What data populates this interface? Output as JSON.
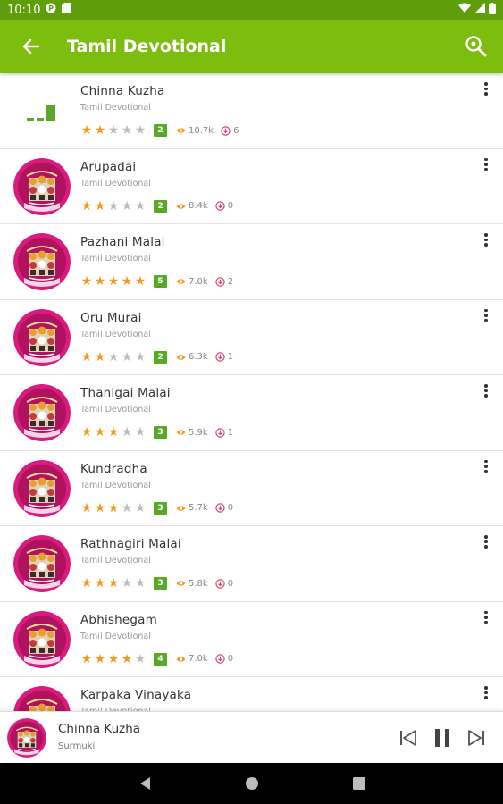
{
  "status_bar": {
    "time": "10:10"
  },
  "app_bar": {
    "title": "Tamil Devotional"
  },
  "colors": {
    "app_bar": "#7cbd0e",
    "status_bar": "#5e9e0a",
    "star_on": "#f39a1e",
    "badge": "#5aa82a"
  },
  "songs": [
    {
      "title": "Chinna Kuzha",
      "subtitle": "Tamil Devotional",
      "rating": 2,
      "badge": "2",
      "views": "10.7k",
      "downloads": "6",
      "playing": true
    },
    {
      "title": "Arupadai",
      "subtitle": "Tamil Devotional",
      "rating": 2,
      "badge": "2",
      "views": "8.4k",
      "downloads": "0",
      "playing": false
    },
    {
      "title": "Pazhani Malai",
      "subtitle": "Tamil Devotional",
      "rating": 5,
      "badge": "5",
      "views": "7.0k",
      "downloads": "2",
      "playing": false
    },
    {
      "title": "Oru Murai",
      "subtitle": "Tamil Devotional",
      "rating": 2,
      "badge": "2",
      "views": "6.3k",
      "downloads": "1",
      "playing": false
    },
    {
      "title": "Thanigai Malai",
      "subtitle": "Tamil Devotional",
      "rating": 3,
      "badge": "3",
      "views": "5.9k",
      "downloads": "1",
      "playing": false
    },
    {
      "title": "Kundradha",
      "subtitle": "Tamil Devotional",
      "rating": 3,
      "badge": "3",
      "views": "5.7k",
      "downloads": "0",
      "playing": false
    },
    {
      "title": "Rathnagiri Malai",
      "subtitle": "Tamil Devotional",
      "rating": 3,
      "badge": "3",
      "views": "5.8k",
      "downloads": "0",
      "playing": false
    },
    {
      "title": "Abhishegam",
      "subtitle": "Tamil Devotional",
      "rating": 4,
      "badge": "4",
      "views": "7.0k",
      "downloads": "0",
      "playing": false
    },
    {
      "title": "Karpaka Vinayaka",
      "subtitle": "Tamil Devotional",
      "rating": 0,
      "badge": "",
      "views": "",
      "downloads": "",
      "playing": false
    }
  ],
  "player": {
    "title": "Chinna Kuzha",
    "subtitle": "Surmuki"
  },
  "icons": {
    "back": "arrow-back-icon",
    "search": "search-icon",
    "more": "more-vert-icon",
    "views": "eye-icon",
    "downloads": "download-icon",
    "prev": "skip-previous-icon",
    "pause": "pause-icon",
    "next": "skip-next-icon"
  }
}
